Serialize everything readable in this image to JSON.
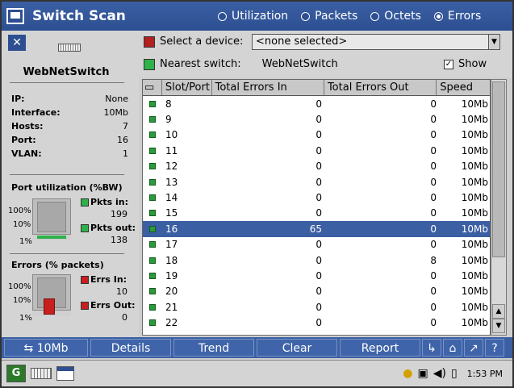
{
  "title": "Switch Scan",
  "modes": [
    {
      "label": "Utilization",
      "selected": false
    },
    {
      "label": "Packets",
      "selected": false
    },
    {
      "label": "Octets",
      "selected": false
    },
    {
      "label": "Errors",
      "selected": true
    }
  ],
  "left": {
    "switch_name": "WebNetSwitch",
    "info": [
      {
        "key": "IP:",
        "value": "None"
      },
      {
        "key": "Interface:",
        "value": "10Mb"
      },
      {
        "key": "Hosts:",
        "value": "7"
      },
      {
        "key": "Port:",
        "value": "16"
      },
      {
        "key": "VLAN:",
        "value": "1"
      }
    ],
    "utilization": {
      "title": "Port utilization (%BW)",
      "scale": [
        "100%",
        "10%",
        "1%"
      ],
      "in_label": "Pkts in:",
      "in_value": "199",
      "out_label": "Pkts out:",
      "out_value": "138",
      "in_color": "#2fb24a",
      "out_color": "#2fb24a"
    },
    "errors": {
      "title": "Errors (% packets)",
      "scale": [
        "100%",
        "10%",
        "1%"
      ],
      "in_label": "Errs In:",
      "in_value": "10",
      "out_label": "Errs Out:",
      "out_value": "0",
      "in_color": "#c81e1e",
      "out_color": "#c81e1e"
    }
  },
  "device": {
    "select_label": "Select a device:",
    "select_value": "<none selected>",
    "nearest_label": "Nearest switch:",
    "nearest_value": "WebNetSwitch",
    "show_label": "Show",
    "show_checked": true,
    "select_color": "#b22020",
    "nearest_color": "#2fb24a"
  },
  "table": {
    "columns": [
      "Slot/Port",
      "Total Errors In",
      "Total Errors Out",
      "Speed"
    ],
    "rows": [
      {
        "port": "8",
        "in": "0",
        "out": "0",
        "speed": "10Mb"
      },
      {
        "port": "9",
        "in": "0",
        "out": "0",
        "speed": "10Mb"
      },
      {
        "port": "10",
        "in": "0",
        "out": "0",
        "speed": "10Mb"
      },
      {
        "port": "11",
        "in": "0",
        "out": "0",
        "speed": "10Mb"
      },
      {
        "port": "12",
        "in": "0",
        "out": "0",
        "speed": "10Mb"
      },
      {
        "port": "13",
        "in": "0",
        "out": "0",
        "speed": "10Mb"
      },
      {
        "port": "14",
        "in": "0",
        "out": "0",
        "speed": "10Mb"
      },
      {
        "port": "15",
        "in": "0",
        "out": "0",
        "speed": "10Mb"
      },
      {
        "port": "16",
        "in": "65",
        "out": "0",
        "speed": "10Mb",
        "selected": true
      },
      {
        "port": "17",
        "in": "0",
        "out": "0",
        "speed": "10Mb"
      },
      {
        "port": "18",
        "in": "0",
        "out": "8",
        "speed": "10Mb"
      },
      {
        "port": "19",
        "in": "0",
        "out": "0",
        "speed": "10Mb"
      },
      {
        "port": "20",
        "in": "0",
        "out": "0",
        "speed": "10Mb"
      },
      {
        "port": "21",
        "in": "0",
        "out": "0",
        "speed": "10Mb"
      },
      {
        "port": "22",
        "in": "0",
        "out": "0",
        "speed": "10Mb"
      }
    ]
  },
  "toolbar": {
    "speed_label": "10Mb",
    "details_label": "Details",
    "trend_label": "Trend",
    "clear_label": "Clear",
    "report_label": "Report",
    "help_label": "?"
  },
  "taskbar": {
    "start_label": "G",
    "clock": "1:53 PM"
  }
}
